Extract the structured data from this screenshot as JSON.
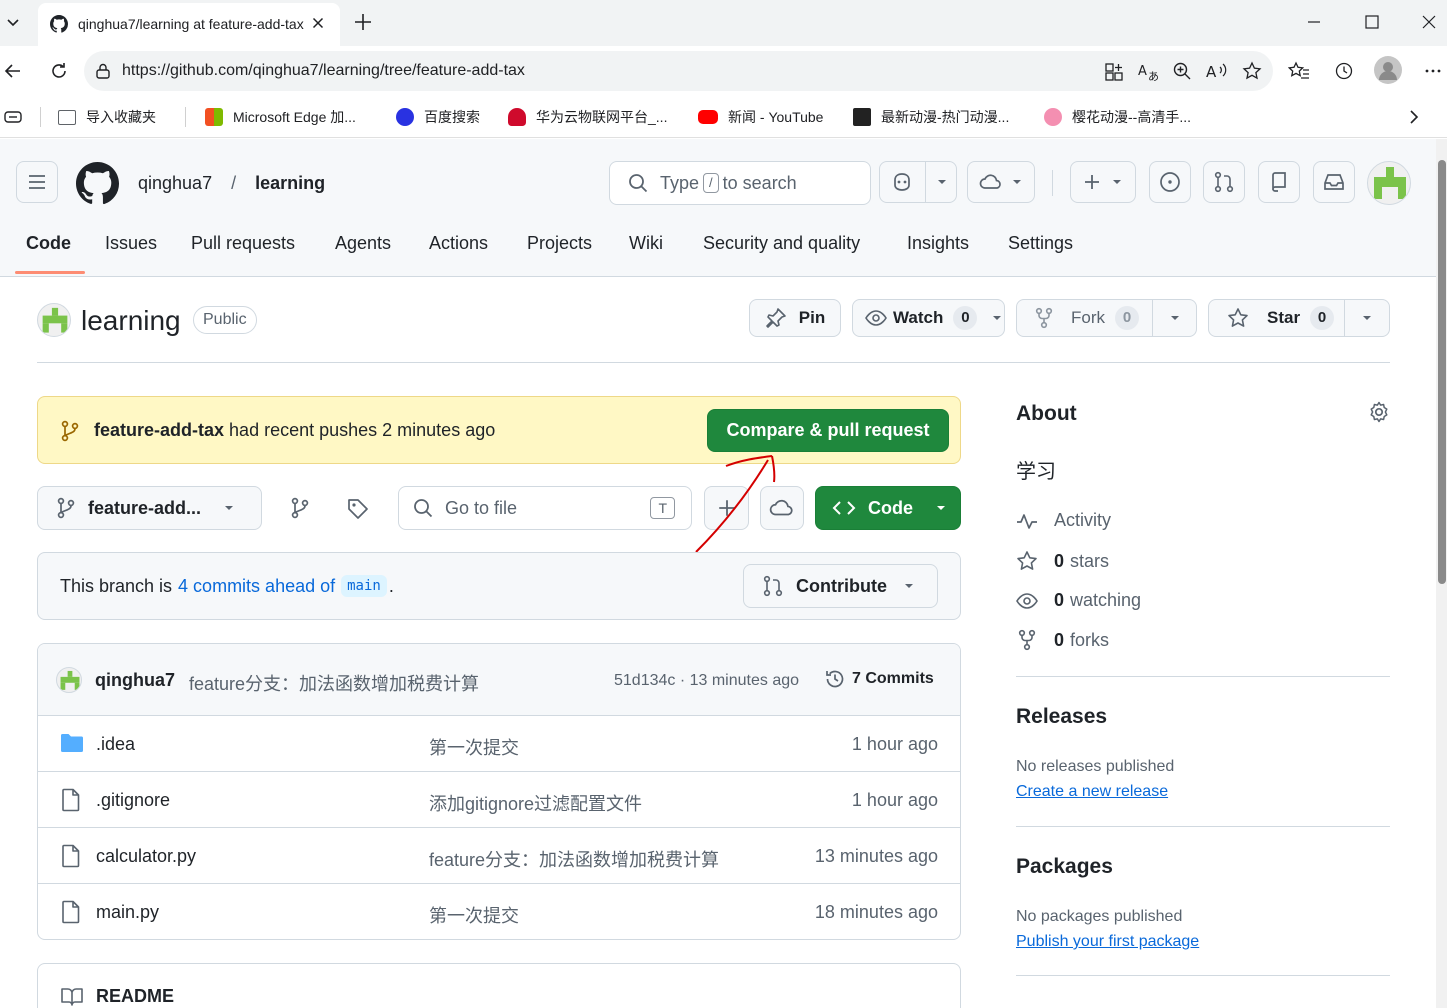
{
  "browser": {
    "tab_title": "qinghua7/learning at feature-add-tax",
    "url": "https://github.com/qinghua7/learning/tree/feature-add-tax",
    "bookmarks": [
      {
        "label": "导入收藏夹",
        "color": "#5f6368"
      },
      {
        "label": "Microsoft Edge 加...",
        "color": "#f25022"
      },
      {
        "label": "百度搜索",
        "color": "#2932e1"
      },
      {
        "label": "华为云物联网平台_...",
        "color": "#cf0a2c"
      },
      {
        "label": "新闻 - YouTube",
        "color": "#ff0000"
      },
      {
        "label": "最新动漫-热门动漫...",
        "color": "#222222"
      },
      {
        "label": "樱花动漫--高清手...",
        "color": "#f48fb1"
      }
    ]
  },
  "header": {
    "owner": "qinghua7",
    "separator": "/",
    "repo": "learning",
    "search_prefix": "Type",
    "search_key": "/",
    "search_suffix": "to search"
  },
  "nav": {
    "tabs": [
      "Code",
      "Issues",
      "Pull requests",
      "Agents",
      "Actions",
      "Projects",
      "Wiki",
      "Security and quality",
      "Insights",
      "Settings"
    ]
  },
  "repo": {
    "name": "learning",
    "visibility": "Public",
    "pin_label": "Pin",
    "watch_label": "Watch",
    "watch_count": "0",
    "fork_label": "Fork",
    "fork_count": "0",
    "star_label": "Star",
    "star_count": "0"
  },
  "flash": {
    "branch": "feature-add-tax",
    "message": "had recent pushes 2 minutes ago",
    "button": "Compare & pull request"
  },
  "filenav": {
    "branch": "feature-add...",
    "goto_placeholder": "Go to file",
    "goto_key": "T",
    "code_label": "Code"
  },
  "ahead": {
    "prefix": "This branch is",
    "link": "4 commits ahead of",
    "base": "main",
    "suffix": ".",
    "contribute_label": "Contribute"
  },
  "commit": {
    "author": "qinghua7",
    "message": "feature分支：加法函数增加税费计算",
    "meta": "51d134c · 13 minutes ago",
    "commits_label": "7 Commits"
  },
  "files": [
    {
      "name": ".idea",
      "type": "folder",
      "message": "第一次提交",
      "time": "1 hour ago"
    },
    {
      "name": ".gitignore",
      "type": "file",
      "message": "添加gitignore过滤配置文件",
      "time": "1 hour ago"
    },
    {
      "name": "calculator.py",
      "type": "file",
      "message": "feature分支：加法函数增加税费计算",
      "time": "13 minutes ago"
    },
    {
      "name": "main.py",
      "type": "file",
      "message": "第一次提交",
      "time": "18 minutes ago"
    }
  ],
  "readme": {
    "label": "README"
  },
  "sidebar": {
    "about_title": "About",
    "description": "学习",
    "activity": "Activity",
    "stars_count": "0",
    "stars_label": "stars",
    "watching_count": "0",
    "watching_label": "watching",
    "forks_count": "0",
    "forks_label": "forks",
    "releases_title": "Releases",
    "releases_none": "No releases published",
    "releases_link": "Create a new release",
    "packages_title": "Packages",
    "packages_none": "No packages published",
    "packages_link": "Publish your first package"
  },
  "colors": {
    "primary_green": "#1f883d",
    "link_blue": "#0969da",
    "flash_bg": "#fff8c5",
    "nav_underline": "#fd8c73",
    "annotation_red": "#d40000"
  }
}
